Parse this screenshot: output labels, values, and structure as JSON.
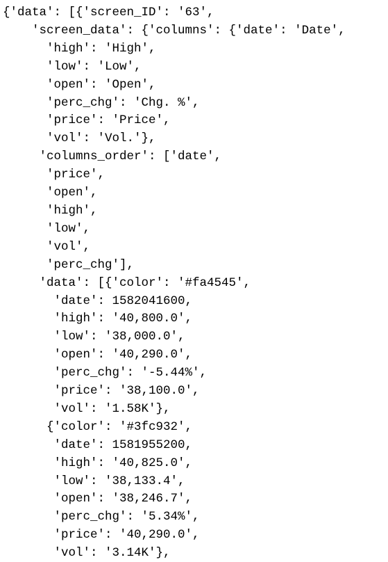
{
  "code_lines": [
    "{'data': [{'screen_ID': '63',",
    "    'screen_data': {'columns': {'date': 'Date',",
    "      'high': 'High',",
    "      'low': 'Low',",
    "      'open': 'Open',",
    "      'perc_chg': 'Chg. %',",
    "      'price': 'Price',",
    "      'vol': 'Vol.'},",
    "     'columns_order': ['date',",
    "      'price',",
    "      'open',",
    "      'high',",
    "      'low',",
    "      'vol',",
    "      'perc_chg'],",
    "     'data': [{'color': '#fa4545',",
    "       'date': 1582041600,",
    "       'high': '40,800.0',",
    "       'low': '38,000.0',",
    "       'open': '40,290.0',",
    "       'perc_chg': '-5.44%',",
    "       'price': '38,100.0',",
    "       'vol': '1.58K'},",
    "      {'color': '#3fc932',",
    "       'date': 1581955200,",
    "       'high': '40,825.0',",
    "       'low': '38,133.4',",
    "       'open': '38,246.7',",
    "       'perc_chg': '5.34%',",
    "       'price': '40,290.0',",
    "       'vol': '3.14K'},"
  ]
}
